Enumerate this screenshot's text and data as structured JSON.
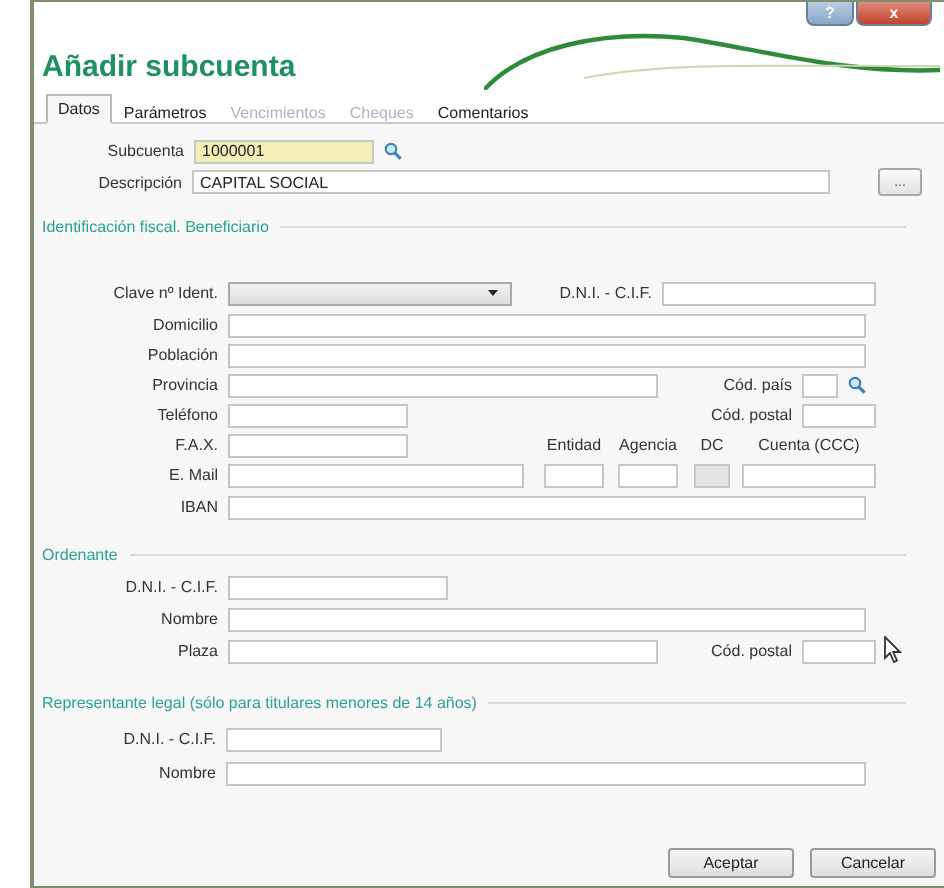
{
  "window": {
    "title": "Añadir subcuenta",
    "controls": [
      {
        "kind": "help",
        "label": "?"
      },
      {
        "kind": "close",
        "label": "x"
      }
    ]
  },
  "tabs": [
    {
      "label": "Datos",
      "selected": true,
      "disabled": false
    },
    {
      "label": "Parámetros",
      "selected": false,
      "disabled": false
    },
    {
      "label": "Vencimientos",
      "selected": false,
      "disabled": true
    },
    {
      "label": "Cheques",
      "selected": false,
      "disabled": true
    },
    {
      "label": "Comentarios",
      "selected": false,
      "disabled": false
    }
  ],
  "subcuenta": {
    "label": "Subcuenta",
    "value": "1000001"
  },
  "descripcion": {
    "label": "Descripción",
    "value": "CAPITAL SOCIAL"
  },
  "more_button": "...",
  "beneficiario": {
    "title": "Identificación fiscal. Beneficiario",
    "clave_label": "Clave nº Ident.",
    "dni_label": "D.N.I. - C.I.F.",
    "domicilio_label": "Domicilio",
    "poblacion_label": "Población",
    "provincia_label": "Provincia",
    "cod_pais_label": "Cód. país",
    "telefono_label": "Teléfono",
    "cod_postal_label": "Cód. postal",
    "fax_label": "F.A.X.",
    "email_label": "E. Mail",
    "iban_label": "IBAN",
    "bank": [
      {
        "label": "Entidad",
        "disabled": false
      },
      {
        "label": "Agencia",
        "disabled": false
      },
      {
        "label": "DC",
        "disabled": true
      },
      {
        "label": "Cuenta (CCC)",
        "disabled": false
      }
    ]
  },
  "ordenante": {
    "title": "Ordenante",
    "dni_label": "D.N.I. - C.I.F.",
    "nombre_label": "Nombre",
    "plaza_label": "Plaza",
    "cod_postal_label": "Cód. postal"
  },
  "representante": {
    "title": "Representante legal (sólo para titulares menores de 14 años)",
    "dni_label": "D.N.I. - C.I.F.",
    "nombre_label": "Nombre"
  },
  "buttons": [
    "Aceptar",
    "Cancelar"
  ]
}
